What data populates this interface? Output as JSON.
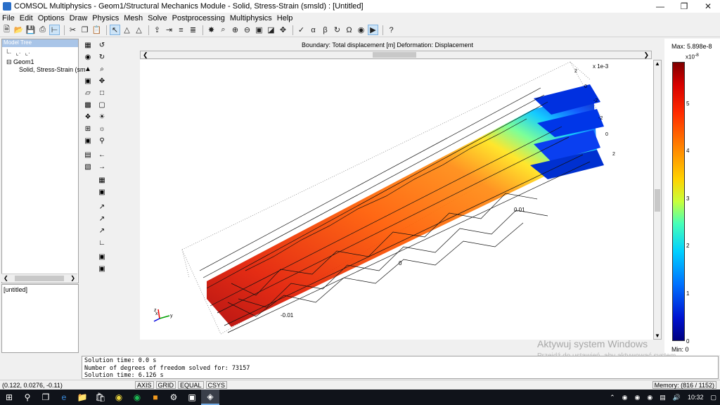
{
  "window": {
    "title": "COMSOL Multiphysics - Geom1/Structural Mechanics Module - Solid, Stress-Strain (smsld) : [Untitled]"
  },
  "menu": [
    "File",
    "Edit",
    "Options",
    "Draw",
    "Physics",
    "Mesh",
    "Solve",
    "Postprocessing",
    "Multiphysics",
    "Help"
  ],
  "model_tree": {
    "header": "Model Tree",
    "nodes": [
      "Geom1",
      "Solid, Stress-Strain (sm"
    ]
  },
  "untitled_pane": "[untitled]",
  "plot": {
    "title": "Boundary: Total displacement [m]   Deformation: Displacement",
    "axis_scale_label": "x 1e-3",
    "tick_labels": [
      "-0.01",
      "0",
      "0.01",
      "2",
      "0",
      "-2",
      "-2",
      "0",
      "2"
    ],
    "triad": {
      "x": "x",
      "y": "y",
      "z": "z"
    }
  },
  "colorbar": {
    "max_label": "Max: 5.898e-8",
    "min_label": "Min: 0",
    "exponent": "x10",
    "exponent_power": "-8",
    "ticks": [
      "5",
      "4",
      "3",
      "2",
      "1",
      "0"
    ]
  },
  "console": [
    "Solution time: 0.0 s",
    "Number of degrees of freedom solved for: 73157",
    "Solution time: 6.126 s"
  ],
  "statusbar": {
    "coords": "(0.122, 0.0276, -0.11)",
    "buttons": [
      "AXIS",
      "GRID",
      "EQUAL",
      "CSYS"
    ],
    "memory": "Memory: (816 / 1152)"
  },
  "watermark": {
    "title": "Aktywuj system Windows",
    "subtitle": "Przejdź do ustawień, aby aktywować system Windows."
  },
  "taskbar": {
    "time": "10:32"
  },
  "colors": {
    "selection": "#cde4f7",
    "taskbar": "#10131a"
  }
}
